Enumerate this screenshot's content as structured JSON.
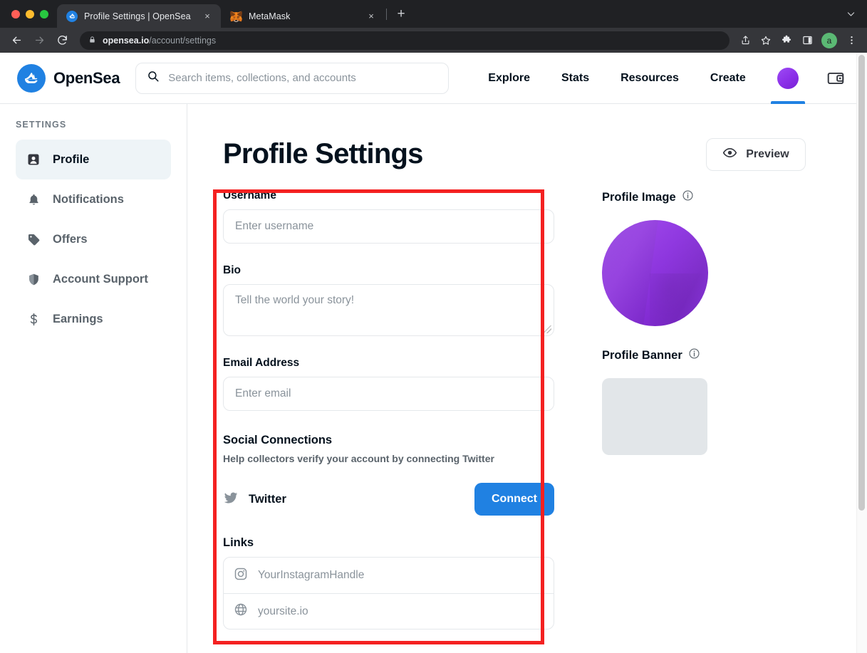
{
  "browser": {
    "tabs": [
      {
        "title": "Profile Settings | OpenSea",
        "favicon": "opensea-icon",
        "active": true,
        "close": "×"
      },
      {
        "title": "MetaMask",
        "favicon": "metamask-fox-icon",
        "active": false,
        "close": "×"
      }
    ],
    "new_tab_label": "+",
    "chevron_label": "⌄",
    "url_domain": "opensea.io",
    "url_path": "/account/settings",
    "profile_initial": "a",
    "nav_back": "back-arrow-icon",
    "nav_forward": "forward-arrow-icon",
    "nav_reload": "reload-icon",
    "toolbar_icons": [
      "share-icon",
      "bookmark-star-icon",
      "extensions-puzzle-icon",
      "side-panel-icon",
      "chrome-profile-avatar",
      "three-dot-menu-icon"
    ]
  },
  "site_header": {
    "brand": "OpenSea",
    "search_placeholder": "Search items, collections, and accounts",
    "nav": [
      {
        "label": "Explore"
      },
      {
        "label": "Stats"
      },
      {
        "label": "Resources"
      },
      {
        "label": "Create"
      }
    ],
    "account_avatar": "user-avatar",
    "wallet_icon": "wallet-icon",
    "accent_color": "#2081e2"
  },
  "sidebar": {
    "title": "SETTINGS",
    "items": [
      {
        "label": "Profile",
        "icon": "user-badge-icon",
        "active": true
      },
      {
        "label": "Notifications",
        "icon": "bell-icon",
        "active": false
      },
      {
        "label": "Offers",
        "icon": "tag-icon",
        "active": false
      },
      {
        "label": "Account Support",
        "icon": "shield-icon",
        "active": false
      },
      {
        "label": "Earnings",
        "icon": "dollar-icon",
        "active": false
      }
    ]
  },
  "main": {
    "page_title": "Profile Settings",
    "preview_button": "Preview",
    "preview_icon": "eye-icon",
    "fields": {
      "username_label": "Username",
      "username_placeholder": "Enter username",
      "bio_label": "Bio",
      "bio_placeholder": "Tell the world your story!",
      "email_label": "Email Address",
      "email_placeholder": "Enter email"
    },
    "social": {
      "title": "Social Connections",
      "subtitle": "Help collectors verify your account by connecting Twitter",
      "provider": "Twitter",
      "provider_icon": "twitter-bird-icon",
      "connect_button": "Connect"
    },
    "links": {
      "title": "Links",
      "rows": [
        {
          "icon": "instagram-icon",
          "placeholder": "YourInstagramHandle"
        },
        {
          "icon": "globe-icon",
          "placeholder": "yoursite.io"
        }
      ]
    },
    "right": {
      "profile_image_label": "Profile Image",
      "profile_banner_label": "Profile Banner",
      "info_icon": "info-circle-icon"
    },
    "highlight_color": "#f42121"
  }
}
